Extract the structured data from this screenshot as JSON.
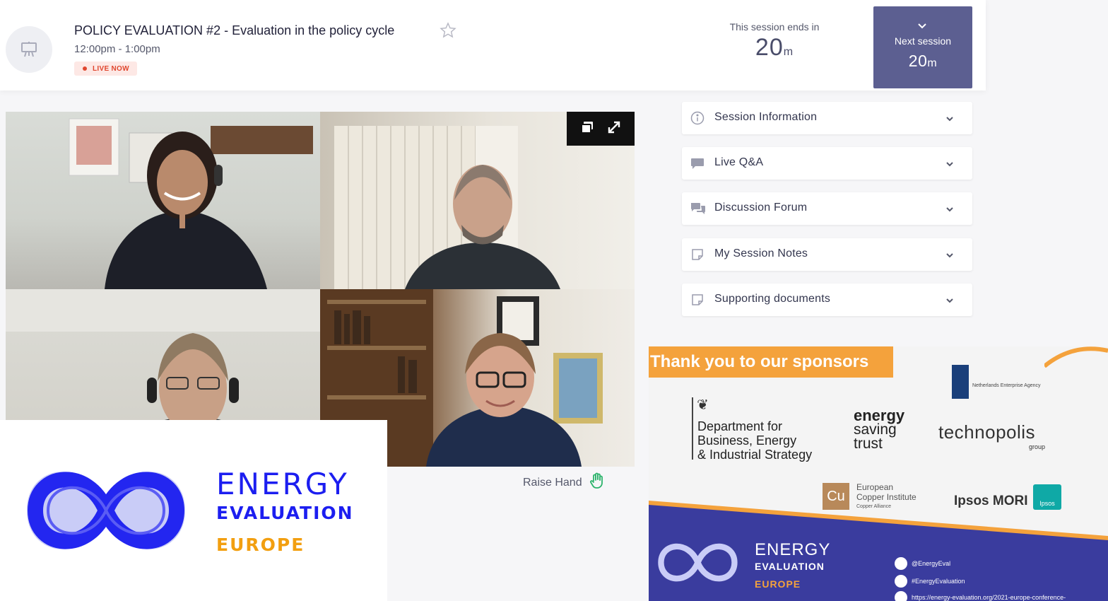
{
  "header": {
    "session_title": "POLICY EVALUATION #2 - Evaluation in the policy cycle",
    "session_time": "12:00pm - 1:00pm",
    "live_badge": "LIVE NOW",
    "ends_label": "This session ends in",
    "ends_value": "20",
    "ends_unit": "m",
    "next_label": "Next session",
    "next_value": "20",
    "next_unit": "m",
    "session_icon": "presentation-board-icon",
    "favorite_icon": "star-outline-icon"
  },
  "video": {
    "controls": [
      "picture-in-picture-icon",
      "fullscreen-icon"
    ],
    "raise_hand_label": "Raise Hand",
    "raise_hand_icon": "hand-icon"
  },
  "panels": [
    {
      "label": "Session Information",
      "icon": "info-icon"
    },
    {
      "label": "Live Q&A",
      "icon": "chat-bubble-icon"
    },
    {
      "label": "Discussion Forum",
      "icon": "chat-bubbles-icon"
    },
    {
      "label": "My Session Notes",
      "icon": "note-icon"
    },
    {
      "label": "Supporting documents",
      "icon": "note-icon"
    }
  ],
  "logo": {
    "line1": "ENERGY",
    "line2": "EVALUATION",
    "line3": "EUROPE"
  },
  "slide": {
    "banner": "Thank you to our sponsors",
    "beis_crest": "❦",
    "beis_lines": [
      "Department for",
      "Business, Energy",
      "& Industrial Strategy"
    ],
    "est_bold": "energy",
    "est_line2": "saving",
    "est_line3": "trust",
    "nl_agency": "Netherlands Enterprise Agency",
    "technopolis": "technopolis",
    "technopolis_group": "group",
    "cu": "Cu",
    "cu_lines": [
      "European",
      "Copper Institute"
    ],
    "cu_small": "Copper Alliance",
    "ipsos_mori": "Ipsos MORI",
    "ipsos_box": "Ipsos",
    "footer_energy": "ENERGY",
    "footer_evaluation": "EVALUATION",
    "footer_europe": "EUROPE",
    "social": [
      "@EnergyEval",
      "#EnergyEvaluation",
      "https://energy-evaluation.org/2021-europe-conference-"
    ]
  },
  "colors": {
    "accent": "#5c5f91",
    "live": "#e0472f",
    "brand_blue": "#1c1ef0",
    "brand_orange": "#f29f10"
  }
}
